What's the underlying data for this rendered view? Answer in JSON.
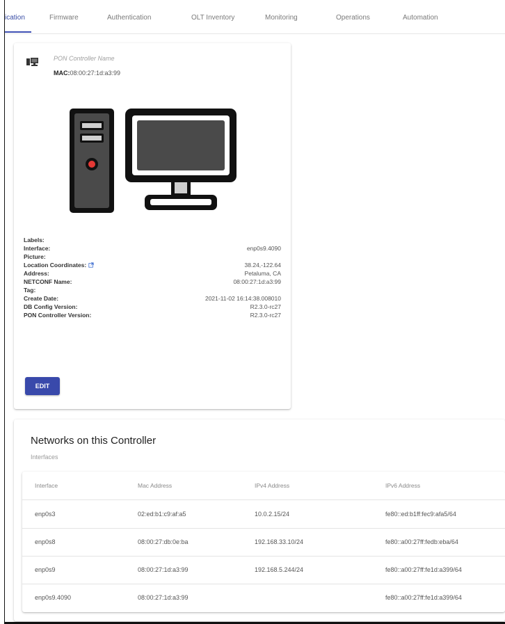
{
  "nav": {
    "tabs": [
      "ication",
      "Firmware",
      "Authentication",
      "OLT Inventory",
      "Monitoring",
      "Operations",
      "Automation"
    ]
  },
  "controller": {
    "name_placeholder": "PON Controller Name",
    "mac_label": "MAC:",
    "mac_value": "08:00:27:1d:a3:99",
    "properties": [
      {
        "key": "Labels:",
        "value": ""
      },
      {
        "key": "Interface:",
        "value": "enp0s9.4090"
      },
      {
        "key": "Picture:",
        "value": ""
      },
      {
        "key": "Location Coordinates:",
        "value": "38.24,-122.64"
      },
      {
        "key": "Address:",
        "value": "Petaluma, CA"
      },
      {
        "key": "NETCONF Name:",
        "value": "08:00:27:1d:a3:99"
      },
      {
        "key": "Tag:",
        "value": ""
      },
      {
        "key": "Create Date:",
        "value": "2021-11-02 16:14:38.008010"
      },
      {
        "key": "DB Config Version:",
        "value": "R2.3.0-rc27"
      },
      {
        "key": "PON Controller Version:",
        "value": "R2.3.0-rc27"
      }
    ],
    "edit_label": "EDIT"
  },
  "networks": {
    "title": "Networks on this Controller",
    "subtitle": "Interfaces",
    "columns": [
      "Interface",
      "Mac Address",
      "IPv4 Address",
      "IPv6 Address"
    ],
    "rows": [
      [
        "enp0s3",
        "02:ed:b1:c9:af:a5",
        "10.0.2.15/24",
        "fe80::ed:b1ff:fec9:afa5/64"
      ],
      [
        "enp0s8",
        "08:00:27:db:0e:ba",
        "192.168.33.10/24",
        "fe80::a00:27ff:fedb:eba/64"
      ],
      [
        "enp0s9",
        "08:00:27:1d:a3:99",
        "192.168.5.244/24",
        "fe80::a00:27ff:fe1d:a399/64"
      ],
      [
        "enp0s9.4090",
        "08:00:27:1d:a3:99",
        "",
        "fe80::a00:27ff:fe1d:a399/64"
      ]
    ]
  },
  "colors": {
    "accent": "#3f51b5",
    "button": "#3949ab"
  },
  "icons": {
    "controller": "pc-small-icon",
    "location": "external-link-icon"
  }
}
